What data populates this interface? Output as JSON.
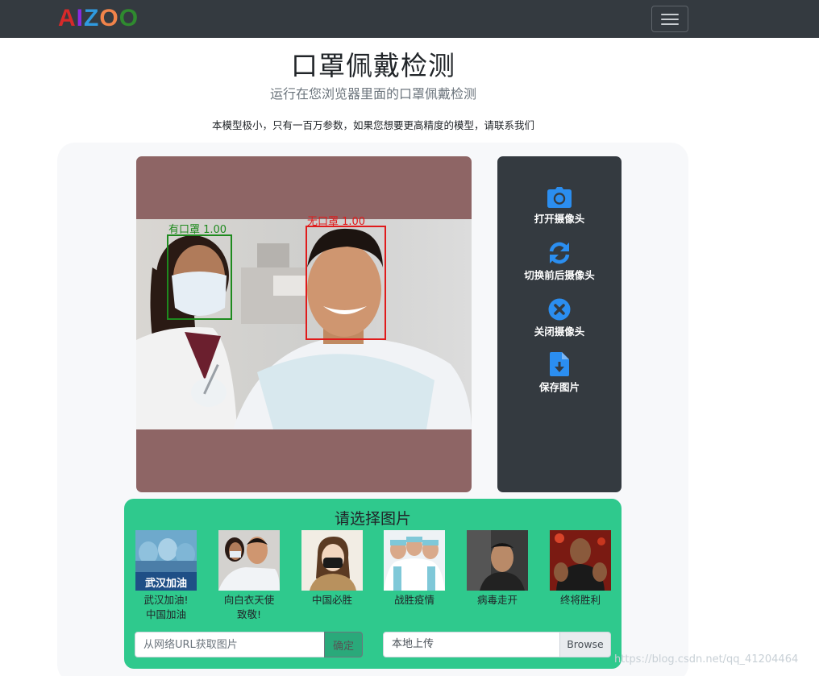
{
  "navbar": {
    "brand_letters": [
      {
        "ch": "A",
        "color": "#d62a2a"
      },
      {
        "ch": "I",
        "color": "#8a2be2"
      },
      {
        "ch": "Z",
        "color": "#2f9ae0"
      },
      {
        "ch": "O",
        "color": "#f0834a"
      },
      {
        "ch": "O",
        "color": "#2f8a2f"
      }
    ],
    "toggler_icon": "hamburger-icon"
  },
  "header": {
    "title": "口罩佩戴检测",
    "subtitle": "运行在您浏览器里面的口罩佩戴检测",
    "note": "本模型极小，只有一百万参数，如果您想要更高精度的模型，请联系我们"
  },
  "detections": [
    {
      "label": "有口罩 1.00",
      "color": "#1e8a1e"
    },
    {
      "label": "无口罩 1.00",
      "color": "#e01b1b"
    }
  ],
  "controls": [
    {
      "label": "打开摄像头",
      "icon": "camera-icon"
    },
    {
      "label": "切换前后摄像头",
      "icon": "sync-icon"
    },
    {
      "label": "关闭摄像头",
      "icon": "close-circle-icon"
    },
    {
      "label": "保存图片",
      "icon": "file-download-icon"
    }
  ],
  "select": {
    "title": "请选择图片",
    "thumbs": [
      {
        "caption1": "武汉加油!",
        "caption2": "中国加油",
        "overlay": "武汉加油"
      },
      {
        "caption1": "向白衣天使",
        "caption2": "致敬!"
      },
      {
        "caption1": "中国必胜",
        "caption2": ""
      },
      {
        "caption1": "战胜疫情",
        "caption2": ""
      },
      {
        "caption1": "病毒走开",
        "caption2": ""
      },
      {
        "caption1": "终将胜利",
        "caption2": ""
      }
    ],
    "url_placeholder": "从网络URL获取图片",
    "url_button": "确定",
    "file_label": "本地上传",
    "file_button": "Browse"
  },
  "watermark": "https://blog.csdn.net/qq_41204464",
  "colors": {
    "navbar": "#343a40",
    "accent_green": "#2fc98d",
    "icon_blue": "#2b8ef0",
    "canvas_bg": "#8e6565"
  }
}
